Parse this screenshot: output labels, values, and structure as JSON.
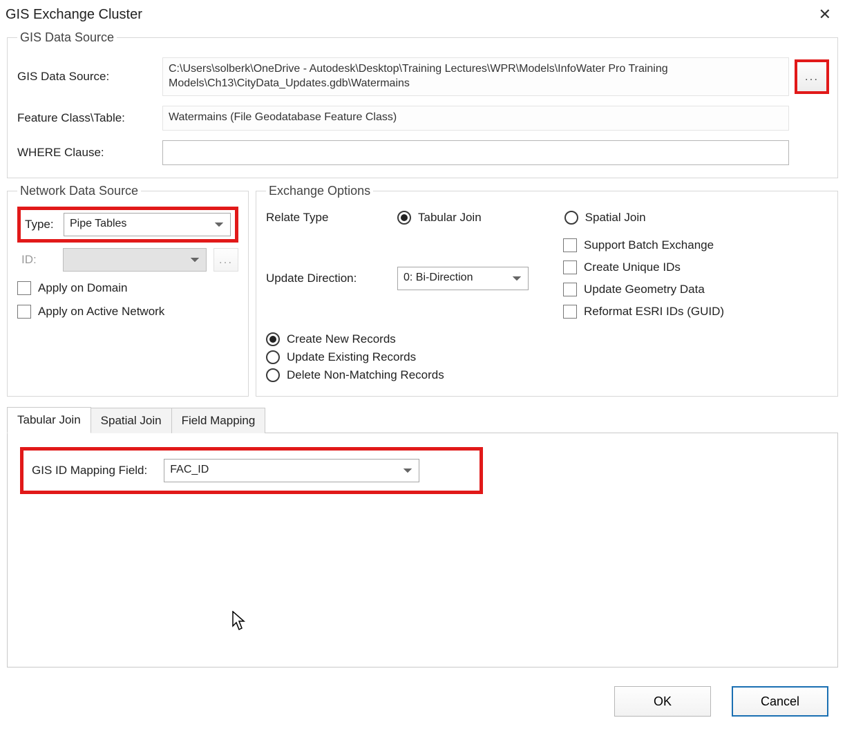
{
  "window": {
    "title": "GIS Exchange Cluster"
  },
  "gis_source": {
    "legend": "GIS Data Source",
    "data_source_label": "GIS Data Source:",
    "data_source_value": "C:\\Users\\solberk\\OneDrive - Autodesk\\Desktop\\Training Lectures\\WPR\\Models\\InfoWater Pro Training Models\\Ch13\\CityData_Updates.gdb\\Watermains",
    "feature_class_label": "Feature Class\\Table:",
    "feature_class_value": "Watermains (File Geodatabase Feature Class)",
    "where_label": "WHERE Clause:",
    "where_value": ""
  },
  "network_source": {
    "legend": "Network Data Source",
    "type_label": "Type:",
    "type_value": "Pipe Tables",
    "id_label": "ID:",
    "apply_domain": "Apply on Domain",
    "apply_active": "Apply on Active Network"
  },
  "exchange": {
    "legend": "Exchange Options",
    "relate_label": "Relate Type",
    "tabular_join": "Tabular Join",
    "spatial_join": "Spatial Join",
    "update_dir_label": "Update Direction:",
    "update_dir_value": "0: Bi-Direction",
    "support_batch": "Support Batch Exchange",
    "create_unique": "Create Unique IDs",
    "update_geom": "Update Geometry Data",
    "reformat_esri": "Reformat ESRI IDs (GUID)",
    "create_new": "Create New Records",
    "update_existing": "Update Existing Records",
    "delete_nonmatch": "Delete Non-Matching Records"
  },
  "tabs": {
    "tabular": "Tabular Join",
    "spatial": "Spatial Join",
    "fieldmap": "Field Mapping"
  },
  "tabular_panel": {
    "gis_id_label": "GIS ID Mapping Field:",
    "gis_id_value": "FAC_ID"
  },
  "buttons": {
    "ok": "OK",
    "cancel": "Cancel",
    "browse": "..."
  }
}
